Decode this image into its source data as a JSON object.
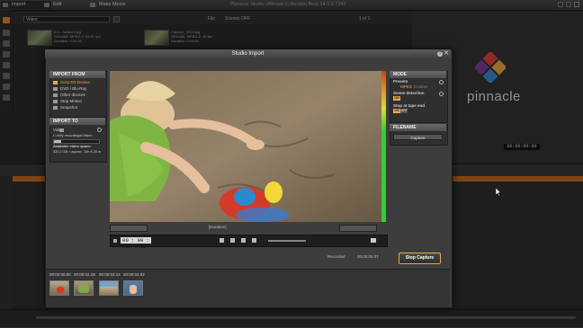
{
  "window": {
    "tabs": [
      {
        "label": "Import"
      },
      {
        "label": "Edit"
      },
      {
        "label": "Make Movie"
      }
    ],
    "title": "Pinnacle Studio Ultimate Collection Beta 14.0.0.7243"
  },
  "library": {
    "selector_value": "Video",
    "filters": {
      "filter1": "Filo",
      "filter2": "Scenes",
      "filter3": "OFF"
    },
    "count": "1 of 3",
    "items": [
      {
        "meta": "E:\\\\...\\\\video.mpg\n720x480, MPEG-2, 29.97 fps\nDuration: 0:00:05"
      },
      {
        "meta": "Capture_001.mpg\n720x480, MPEG-2, 30 fps\nDuration: 0:00:06"
      }
    ]
  },
  "preview": {
    "logo_text": "pinnacle",
    "time": "00:00:00:00"
  },
  "dialog": {
    "title": "Studio Import",
    "import_from": {
      "header": "IMPORT FROM",
      "items": [
        {
          "label": "Sony DV Device",
          "selected": true
        },
        {
          "label": "DVD / Blu-Ray",
          "selected": false
        },
        {
          "label": "Other devices",
          "selected": false
        },
        {
          "label": "Stop Motion",
          "selected": false
        },
        {
          "label": "Snapshot",
          "selected": false
        }
      ]
    },
    "import_to": {
      "header": "IMPORT TO",
      "type_label": "Video",
      "path": "C:\\\\My recordings\\\\Video",
      "space_label": "Available video space:",
      "space_value": "320.2 GB = approx. 19h 6 25 m"
    },
    "mode": {
      "header": "MODE",
      "presets_label": "Presets",
      "presets_value": "MPEG",
      "presets_custom": "Custom",
      "scene_detection_label": "Scene detection",
      "scene_detection_toggle": "ON",
      "stop_at_tape_end_label": "Stop at tape end",
      "stop_toggle_on": "ON",
      "stop_toggle_off": "OFF"
    },
    "filename": {
      "header": "FILENAME",
      "value": "Capture"
    },
    "player": {
      "duration_label": "[Duration]",
      "timecode": "00 : 00 : 08 . 12"
    },
    "recorded_label": "Recorded",
    "recorded_value": "00:00:06.07",
    "stop_capture_label": "Stop Capture",
    "filmstrip": [
      {
        "time": "00:00:00.00"
      },
      {
        "time": "00:00:02.19"
      },
      {
        "time": "00:00:03.14"
      },
      {
        "time": "00:00:04.02"
      }
    ]
  },
  "colors": {
    "accent": "#f0a640",
    "timeline_ruler": "#c86a1e"
  }
}
